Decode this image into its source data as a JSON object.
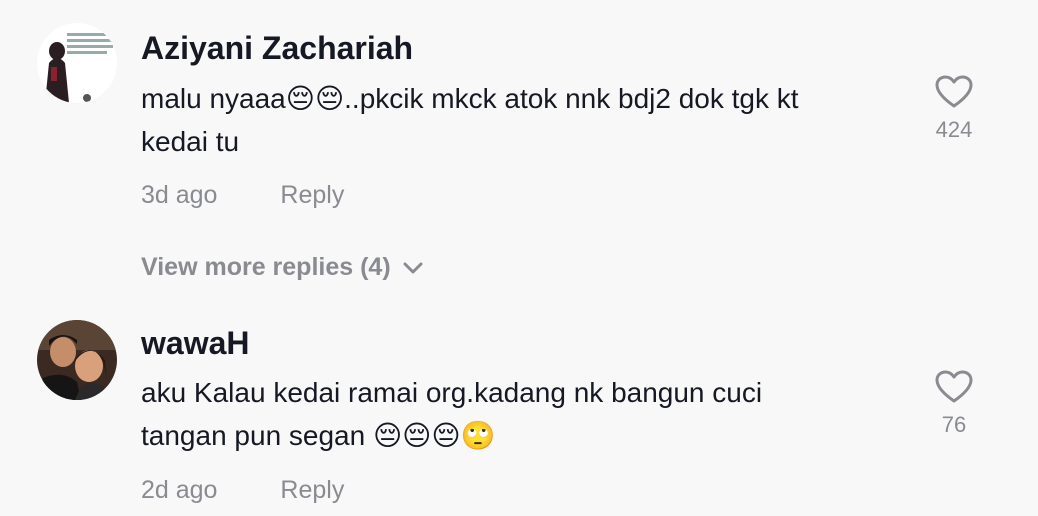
{
  "comments": [
    {
      "author": "Aziyani Zachariah",
      "line1": "malu nyaaa😔😔..pkcik mkck atok nnk bdj2 dok tgk kt",
      "line2": "kedai tu",
      "time": "3d ago",
      "reply_label": "Reply",
      "likes": "424",
      "avatar_icon": "avatar-image"
    },
    {
      "author": "wawaH",
      "line1": "aku Kalau kedai ramai org.kadang nk bangun cuci",
      "line2": "tangan pun segan 😔😔😔🙄",
      "time": "2d ago",
      "reply_label": "Reply",
      "likes": "76",
      "avatar_icon": "avatar-image"
    }
  ],
  "view_more": "View more replies (4)",
  "icons": {
    "like": "heart-outline-icon",
    "expand": "chevron-down-icon"
  },
  "colors": {
    "background": "#f8f8f8",
    "text_primary": "#161823",
    "text_secondary": "#8a8b91"
  }
}
